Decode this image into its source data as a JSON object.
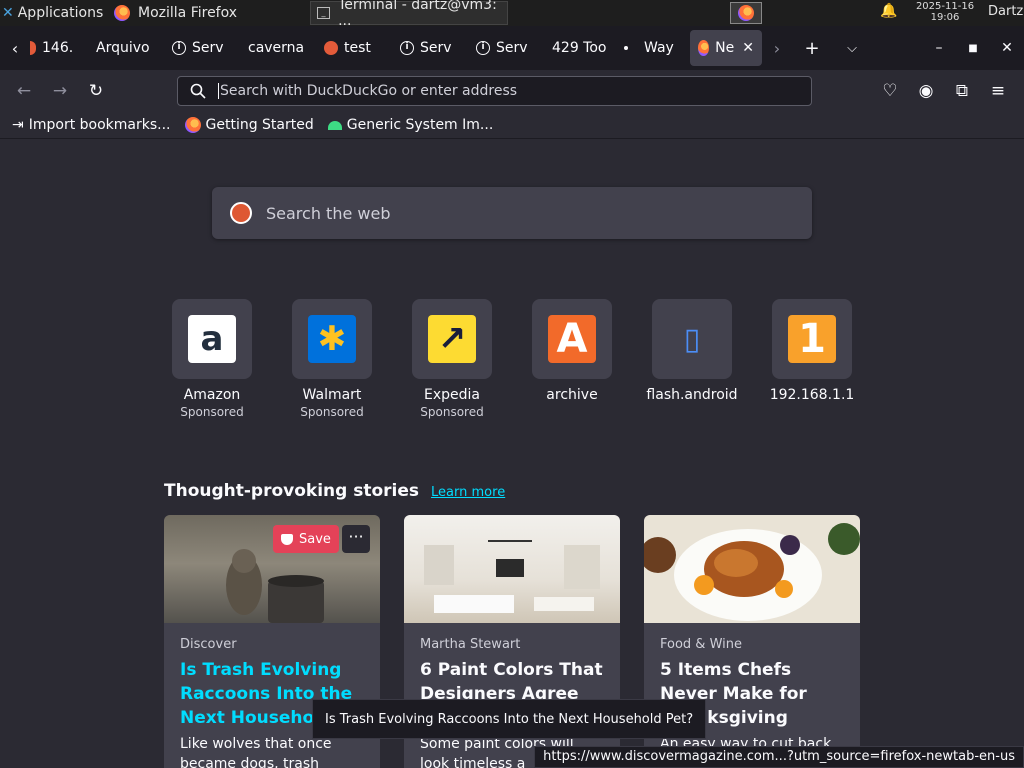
{
  "taskbar": {
    "apps_label": "Applications",
    "firefox_task": "Mozilla Firefox",
    "terminal_task": "Terminal - dartz@vm3: ...",
    "clock_date": "2025-11-16",
    "clock_time": "19:06",
    "user": "Dartz"
  },
  "tabs": [
    {
      "label": "146.",
      "icon": "red-dot-icon"
    },
    {
      "label": "Arquivo",
      "icon": "none"
    },
    {
      "label": "Serv",
      "icon": "info-icon"
    },
    {
      "label": "caverna",
      "icon": "none"
    },
    {
      "label": "test",
      "icon": "red-dot-icon"
    },
    {
      "label": "Serv",
      "icon": "info-icon"
    },
    {
      "label": "Serv",
      "icon": "info-icon"
    },
    {
      "label": "429 Too",
      "icon": "none"
    },
    {
      "label": "Way",
      "icon": "dot-icon"
    },
    {
      "label": "Ne",
      "icon": "firefox-icon",
      "active": true
    }
  ],
  "navbar": {
    "url_placeholder": "Search with DuckDuckGo or enter address"
  },
  "bookmarks": [
    {
      "label": "Import bookmarks...",
      "icon": "import-icon"
    },
    {
      "label": "Getting Started",
      "icon": "firefox-icon"
    },
    {
      "label": "Generic System Im...",
      "icon": "android-icon"
    }
  ],
  "newtab": {
    "search_placeholder": "Search the web",
    "shortcuts": [
      {
        "title": "Amazon",
        "sponsor": "Sponsored",
        "bg": "#ffffff",
        "fg": "#232f3e",
        "glyph": "a"
      },
      {
        "title": "Walmart",
        "sponsor": "Sponsored",
        "bg": "#0071dc",
        "fg": "#ffc220",
        "glyph": "✱"
      },
      {
        "title": "Expedia",
        "sponsor": "Sponsored",
        "bg": "#fddb32",
        "fg": "#191e3b",
        "glyph": "↗"
      },
      {
        "title": "archive",
        "sponsor": "",
        "bg": "#f26a2a",
        "fg": "#ffffff",
        "glyph": "A"
      },
      {
        "title": "flash.android",
        "sponsor": "",
        "bg": "#42414d",
        "fg": "#4c8ef7",
        "glyph": "▯"
      },
      {
        "title": "192.168.1.1",
        "sponsor": "",
        "bg": "#f9a12b",
        "fg": "#ffffff",
        "glyph": "1"
      }
    ],
    "stories_title": "Thought-provoking stories",
    "learn_more": "Learn more",
    "save_label": "Save",
    "more_label": "···",
    "cards": [
      {
        "source": "Discover",
        "title": "Is Trash Evolving Raccoons Into the Next Househo",
        "excerpt": "Like wolves that once became dogs, trash"
      },
      {
        "source": "Martha Stewart",
        "title": "6 Paint Colors That Designers Agree Will Look Outdat",
        "excerpt": "Some paint colors will look timeless a"
      },
      {
        "source": "Food & Wine",
        "title": "5 Items Chefs Never Make for Thanksgiving",
        "excerpt": "An easy way to cut back"
      }
    ],
    "tooltip": "Is Trash Evolving Raccoons Into the Next Household Pet?",
    "status_url": "https://www.discovermagazine.com...?utm_source=firefox-newtab-en-us"
  }
}
